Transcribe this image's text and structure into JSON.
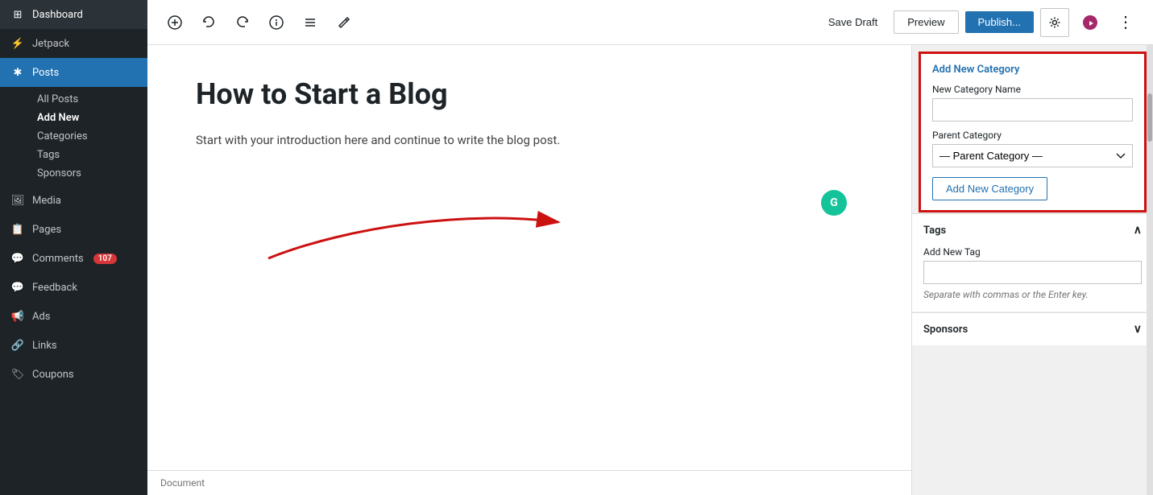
{
  "sidebar": {
    "items": [
      {
        "id": "dashboard",
        "label": "Dashboard",
        "icon": "⊞"
      },
      {
        "id": "jetpack",
        "label": "Jetpack",
        "icon": "⚡"
      },
      {
        "id": "posts",
        "label": "Posts",
        "icon": "📄",
        "active": true
      },
      {
        "id": "media",
        "label": "Media",
        "icon": "🖼"
      },
      {
        "id": "pages",
        "label": "Pages",
        "icon": "📋"
      },
      {
        "id": "comments",
        "label": "Comments",
        "icon": "💬",
        "badge": "107"
      },
      {
        "id": "feedback",
        "label": "Feedback",
        "icon": "📝"
      },
      {
        "id": "ads",
        "label": "Ads",
        "icon": "📢"
      },
      {
        "id": "links",
        "label": "Links",
        "icon": "🔗"
      },
      {
        "id": "coupons",
        "label": "Coupons",
        "icon": "🏷"
      }
    ],
    "posts_subitems": [
      {
        "id": "all-posts",
        "label": "All Posts"
      },
      {
        "id": "add-new",
        "label": "Add New",
        "active": true
      },
      {
        "id": "categories",
        "label": "Categories"
      },
      {
        "id": "tags",
        "label": "Tags"
      },
      {
        "id": "sponsors",
        "label": "Sponsors"
      }
    ]
  },
  "toolbar": {
    "save_draft_label": "Save Draft",
    "preview_label": "Preview",
    "publish_label": "Publish...",
    "icons": {
      "add": "+",
      "undo": "↺",
      "redo": "↻",
      "info": "ⓘ",
      "list": "≡",
      "edit": "✎"
    }
  },
  "editor": {
    "title": "How to Start a Blog",
    "body": "Start with your introduction here and continue to write the blog post.",
    "footer_label": "Document"
  },
  "right_panel": {
    "category_section": {
      "add_new_category_label": "Add New Category",
      "new_category_name_label": "New Category Name",
      "parent_category_label": "Parent Category",
      "parent_category_placeholder": "— Parent Category —",
      "add_button_label": "Add New Category"
    },
    "tags_section": {
      "title": "Tags",
      "add_new_tag_label": "Add New Tag",
      "hint": "Separate with commas or the Enter key."
    },
    "sponsors_section": {
      "title": "Sponsors"
    }
  }
}
